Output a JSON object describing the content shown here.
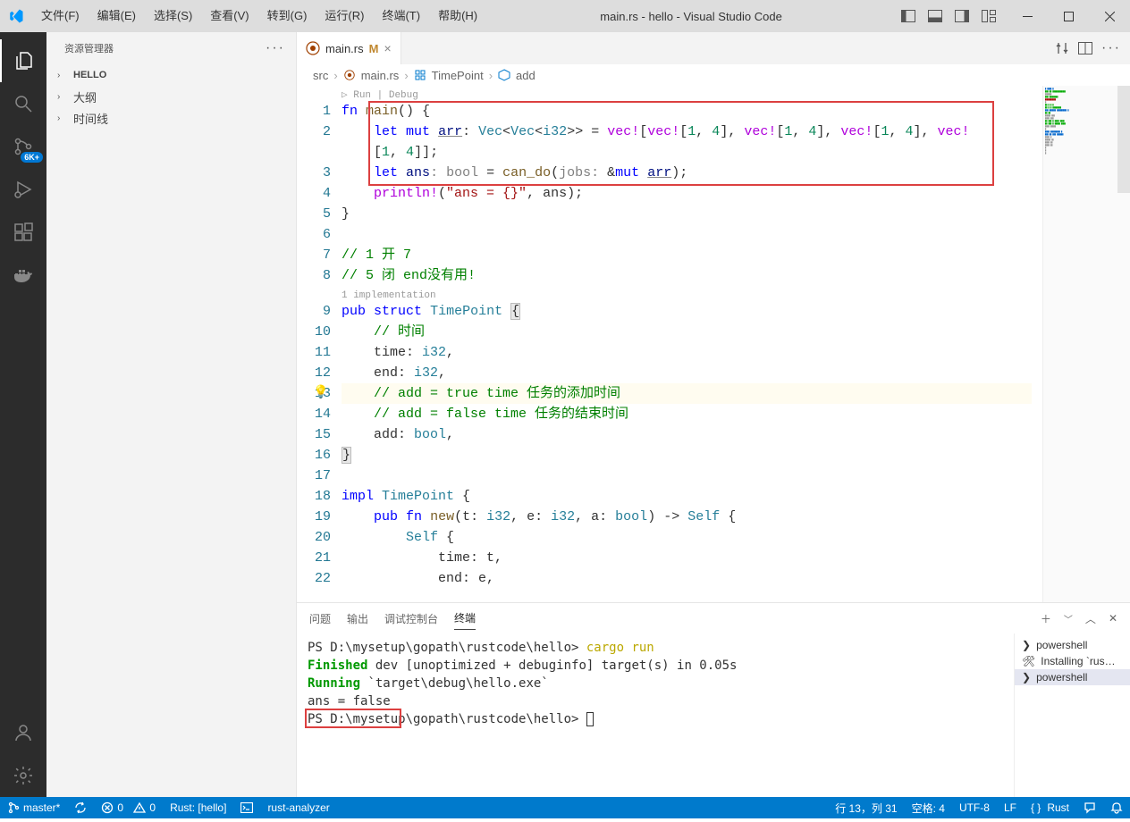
{
  "title": "main.rs - hello - Visual Studio Code",
  "menu": [
    "文件(F)",
    "编辑(E)",
    "选择(S)",
    "查看(V)",
    "转到(G)",
    "运行(R)",
    "终端(T)",
    "帮助(H)"
  ],
  "scm_badge": "6K+",
  "sidebar": {
    "title": "资源管理器",
    "items": [
      "HELLO",
      "大纲",
      "时间线"
    ]
  },
  "tab": {
    "name": "main.rs",
    "modified": "M"
  },
  "breadcrumb": [
    "src",
    "main.rs",
    "TimePoint",
    "add"
  ],
  "codelens": "Run | Debug",
  "impl_hint": "1 implementation",
  "code": {
    "l1": "fn main() {",
    "l2a": "    let mut arr: Vec<Vec<i32>> = vec![vec![1, 4], vec![1, 4], vec![1, 4], vec!",
    "l2b": "    [1, 4]];",
    "l3": "    let ans: bool = can_do(jobs: &mut arr);",
    "l4": "    println!(\"ans = {}\", ans);",
    "l5": "}",
    "l7a": "// 1 开 7",
    "l7b": "// 5 闭 end没有用!",
    "l9": "pub struct TimePoint {",
    "l10": "    // 时间",
    "l11": "    time: i32,",
    "l12": "    end: i32,",
    "l13": "    // add = true time 任务的添加时间",
    "l14": "    // add = false time 任务的结束时间",
    "l15": "    add: bool,",
    "l16": "}",
    "l18": "impl TimePoint {",
    "l19": "    pub fn new(t: i32, e: i32, a: bool) -> Self {",
    "l20": "        Self {",
    "l21": "            time: t,",
    "l22": "            end: e,"
  },
  "panel": {
    "tabs": [
      "问题",
      "输出",
      "调试控制台",
      "终端"
    ],
    "terminal": {
      "l1_pre": "PS D:\\mysetup\\gopath\\rustcode\\hello> ",
      "l1_cmd": "cargo run",
      "l2a": "Finished",
      "l2b": " dev [unoptimized + debuginfo] target(s) in 0.05s",
      "l3a": "Running",
      "l3b": " `target\\debug\\hello.exe`",
      "l4": "ans = false",
      "l5": "PS D:\\mysetup\\gopath\\rustcode\\hello> "
    },
    "shells": [
      "powershell",
      "Installing `rus…",
      "powershell"
    ]
  },
  "status": {
    "branch": "master*",
    "errors": "0",
    "warnings": "0",
    "rust": "Rust: [hello]",
    "analyzer": "rust-analyzer",
    "pos": "行 13，列 31",
    "spaces": "空格: 4",
    "enc": "UTF-8",
    "eol": "LF",
    "lang": "Rust"
  }
}
